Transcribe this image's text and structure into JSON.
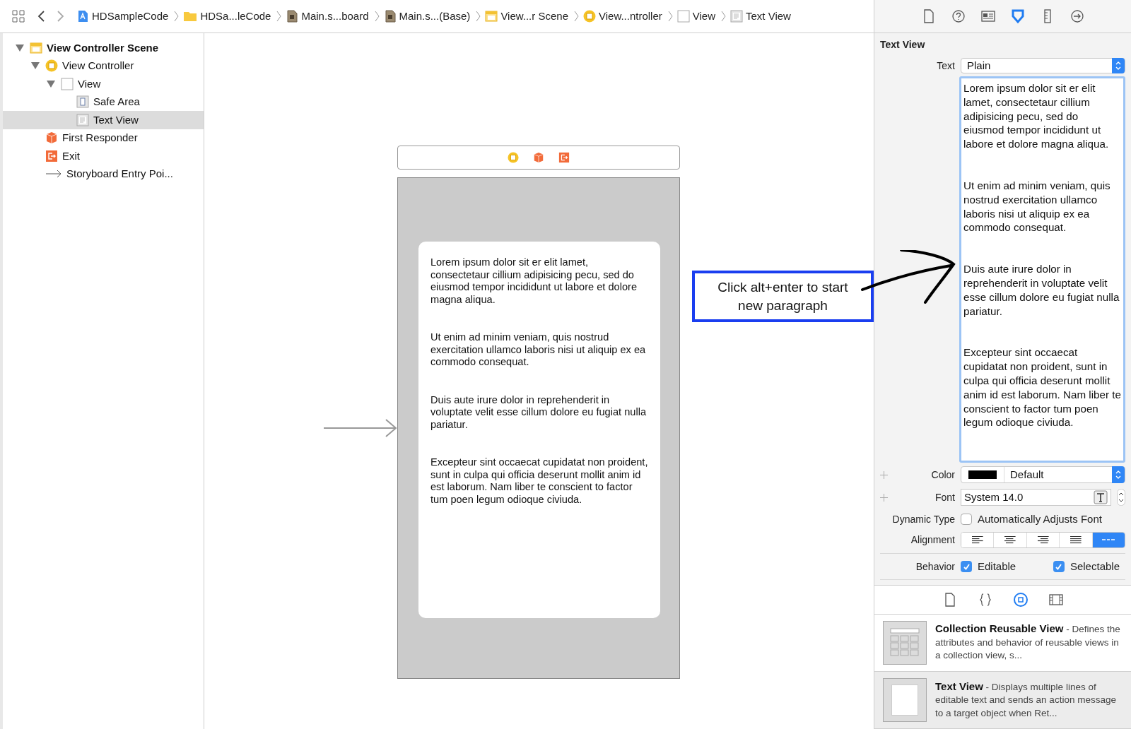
{
  "breadcrumbs": [
    {
      "label": "HDSampleCode",
      "kind": "project"
    },
    {
      "label": "HDSa...leCode",
      "kind": "folder"
    },
    {
      "label": "Main.s...board",
      "kind": "storyboard"
    },
    {
      "label": "Main.s...(Base)",
      "kind": "storyboard"
    },
    {
      "label": "View...r Scene",
      "kind": "scene"
    },
    {
      "label": "View...ntroller",
      "kind": "controller"
    },
    {
      "label": "View",
      "kind": "view"
    },
    {
      "label": "Text View",
      "kind": "textview"
    }
  ],
  "outline": [
    {
      "label": "View Controller Scene",
      "kind": "scene",
      "expanded": true,
      "selected": false,
      "children": [
        {
          "label": "View Controller",
          "kind": "controller",
          "expanded": true,
          "selected": false,
          "children": [
            {
              "label": "View",
              "kind": "view",
              "expanded": true,
              "selected": false,
              "children": [
                {
                  "label": "Safe Area",
                  "kind": "safearea",
                  "selected": false
                },
                {
                  "label": "Text View",
                  "kind": "textview",
                  "selected": true
                }
              ]
            }
          ]
        },
        {
          "label": "First Responder",
          "kind": "responder",
          "selected": false
        },
        {
          "label": "Exit",
          "kind": "exit",
          "selected": false
        },
        {
          "label": "Storyboard Entry Poi...",
          "kind": "entry",
          "selected": false
        }
      ]
    }
  ],
  "canvas": {
    "dock": [
      {
        "kind": "controller"
      },
      {
        "kind": "responder"
      },
      {
        "kind": "exit"
      }
    ],
    "paragraphs": [
      "Lorem ipsum dolor sit er elit lamet, consectetaur cillium adipisicing pecu, sed do eiusmod tempor incididunt ut labore et dolore magna aliqua.",
      "Ut enim ad minim veniam, quis nostrud exercitation ullamco laboris nisi ut aliquip ex ea commodo consequat.",
      "Duis aute irure dolor in reprehenderit in voluptate velit esse cillum dolore eu fugiat nulla pariatur.",
      "Excepteur sint occaecat cupidatat non proident, sunt in culpa qui officia deserunt mollit anim id est laborum. Nam liber te conscient to factor tum poen legum odioque civiuda."
    ],
    "annotation": "Click alt+enter to start new paragraph"
  },
  "inspector": {
    "tabs": [
      {
        "kind": "file",
        "selected": false
      },
      {
        "kind": "help",
        "selected": false
      },
      {
        "kind": "identity",
        "selected": false
      },
      {
        "kind": "attributes",
        "selected": true
      },
      {
        "kind": "size",
        "selected": false
      },
      {
        "kind": "connections",
        "selected": false
      }
    ],
    "title": "Text View",
    "text_label": "Text",
    "text_type": "Plain",
    "text_paragraphs": [
      "Lorem ipsum dolor sit er elit lamet, consectetaur cillium adipisicing pecu, sed do eiusmod tempor incididunt ut labore et dolore magna aliqua.",
      "Ut enim ad minim veniam, quis nostrud exercitation ullamco laboris nisi ut aliquip ex ea commodo consequat.",
      "Duis aute irure dolor in reprehenderit in voluptate velit esse cillum dolore eu fugiat nulla pariatur.",
      "Excepteur sint occaecat cupidatat non proident, sunt in culpa qui officia deserunt mollit anim id est laborum. Nam liber te conscient to factor tum poen legum odioque civiuda."
    ],
    "color_label": "Color",
    "color_value": "Default",
    "font_label": "Font",
    "font_value": "System 14.0",
    "dynamic_type_label": "Dynamic Type",
    "auto_adjust": {
      "label": "Automatically Adjusts Font",
      "checked": false
    },
    "alignment_label": "Alignment",
    "alignments": [
      {
        "kind": "left",
        "selected": false
      },
      {
        "kind": "center",
        "selected": false
      },
      {
        "kind": "right",
        "selected": false
      },
      {
        "kind": "justified",
        "selected": false
      },
      {
        "kind": "natural",
        "selected": true
      }
    ],
    "behavior_label": "Behavior",
    "behaviors": [
      {
        "label": "Editable",
        "checked": true
      },
      {
        "label": "Selectable",
        "checked": true
      }
    ]
  },
  "library": {
    "tabs": [
      {
        "kind": "file",
        "selected": false
      },
      {
        "kind": "code",
        "selected": false
      },
      {
        "kind": "object",
        "selected": true
      },
      {
        "kind": "media",
        "selected": false
      }
    ],
    "items": [
      {
        "kind": "collection",
        "title": "Collection Reusable View",
        "separator": "-",
        "description": "Defines the attributes and behavior of reusable views in a collection view, s...",
        "selected": false
      },
      {
        "kind": "textview",
        "title": "Text View",
        "separator": "-",
        "description": "Displays multiple lines of editable text and sends an action message to a target object when Ret...",
        "selected": true
      }
    ]
  }
}
